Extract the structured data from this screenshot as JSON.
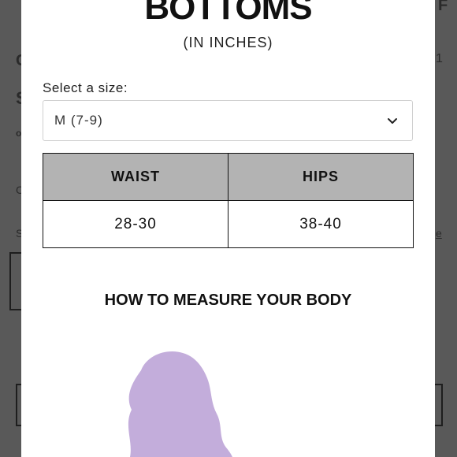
{
  "modal": {
    "title": "BOTTOMS",
    "subtitle": "(IN INCHES)",
    "select_label": "Select a size:",
    "select_value": "M (7-9)",
    "table": {
      "headers": [
        "WAIST",
        "HIPS"
      ],
      "rows": [
        [
          "28-30",
          "38-40"
        ]
      ],
      "header_bg": "#b3b3b3"
    },
    "measure_heading": "HOW TO MEASURE YOUR BODY",
    "figure_color": "#c3addb"
  },
  "background": {
    "overlay_color": "#595959",
    "fragments": [
      "C",
      "S",
      "o",
      "C",
      "S",
      "1",
      "e",
      "F"
    ]
  }
}
